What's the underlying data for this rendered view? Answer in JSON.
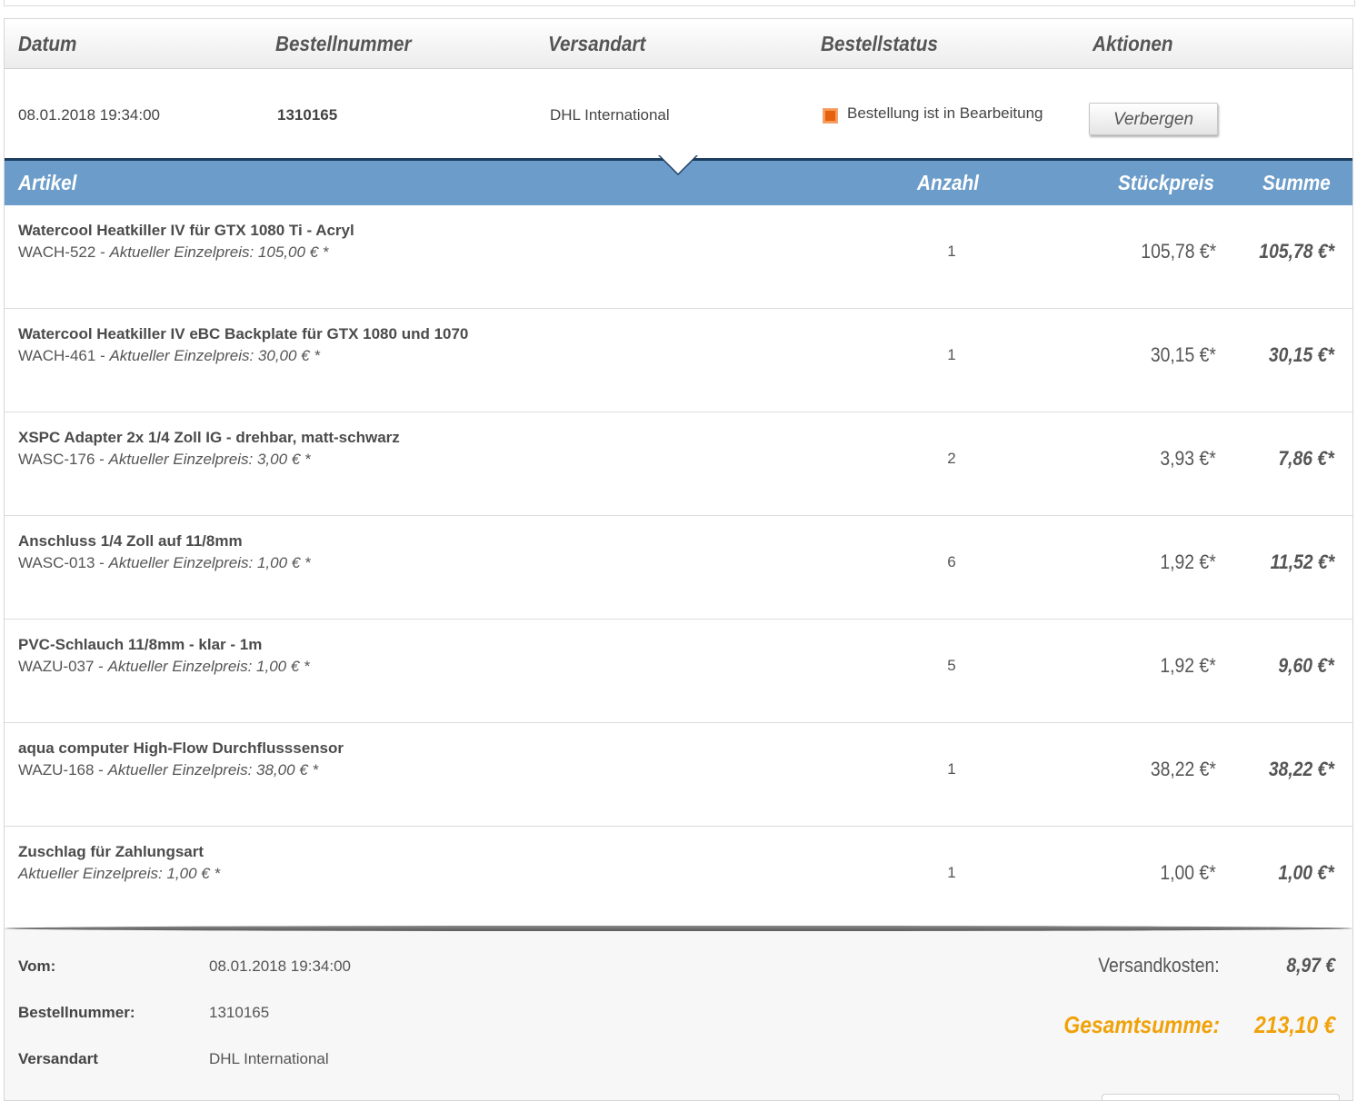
{
  "header": {
    "date": "Datum",
    "order_number": "Bestellnummer",
    "shipping": "Versandart",
    "status": "Bestellstatus",
    "actions": "Aktionen"
  },
  "order": {
    "date": "08.01.2018 19:34:00",
    "number": "1310165",
    "shipping": "DHL International",
    "status": "Bestellung ist in Bearbeitung",
    "status_color": "#e5600f",
    "hide_button": "Verbergen"
  },
  "items_header": {
    "article": "Artikel",
    "qty": "Anzahl",
    "unit_price": "Stückpreis",
    "sum": "Summe"
  },
  "items": [
    {
      "name": "Watercool Heatkiller IV für GTX 1080 Ti - Acryl",
      "sku": "WACH-522",
      "price_note": "Aktueller Einzelpreis: 105,00 € *",
      "qty": "1",
      "unit": "105,78 €*",
      "sum": "105,78 €*"
    },
    {
      "name": "Watercool Heatkiller IV eBC Backplate für GTX 1080 und 1070",
      "sku": "WACH-461",
      "price_note": "Aktueller Einzelpreis: 30,00 € *",
      "qty": "1",
      "unit": "30,15 €*",
      "sum": "30,15 €*"
    },
    {
      "name": "XSPC Adapter 2x 1/4 Zoll IG - drehbar, matt-schwarz",
      "sku": "WASC-176",
      "price_note": "Aktueller Einzelpreis: 3,00 € *",
      "qty": "2",
      "unit": "3,93 €*",
      "sum": "7,86 €*"
    },
    {
      "name": "Anschluss 1/4 Zoll auf 11/8mm",
      "sku": "WASC-013",
      "price_note": "Aktueller Einzelpreis: 1,00 € *",
      "qty": "6",
      "unit": "1,92 €*",
      "sum": "11,52 €*"
    },
    {
      "name": "PVC-Schlauch 11/8mm - klar - 1m",
      "sku": "WAZU-037",
      "price_note": "Aktueller Einzelpreis: 1,00 € *",
      "qty": "5",
      "unit": "1,92 €*",
      "sum": "9,60 €*"
    },
    {
      "name": "aqua computer High-Flow Durchflusssensor",
      "sku": "WAZU-168",
      "price_note": "Aktueller Einzelpreis: 38,00 € *",
      "qty": "1",
      "unit": "38,22 €*",
      "sum": "38,22 €*"
    },
    {
      "name": "Zuschlag für Zahlungsart",
      "sku": "",
      "price_note": "Aktueller Einzelpreis: 1,00 € *",
      "qty": "1",
      "unit": "1,00 €*",
      "sum": "1,00 €*"
    }
  ],
  "footer": {
    "from_label": "Vom:",
    "from_value": "08.01.2018 19:34:00",
    "order_label": "Bestellnummer:",
    "order_value": "1310165",
    "shipping_label": "Versandart",
    "shipping_value": "DHL International",
    "shipping_cost_label": "Versandkosten:",
    "shipping_cost_value": "8,97 €",
    "total_label": "Gesamtsumme:",
    "total_value": "213,10 €",
    "total_color": "#f0a20a"
  }
}
